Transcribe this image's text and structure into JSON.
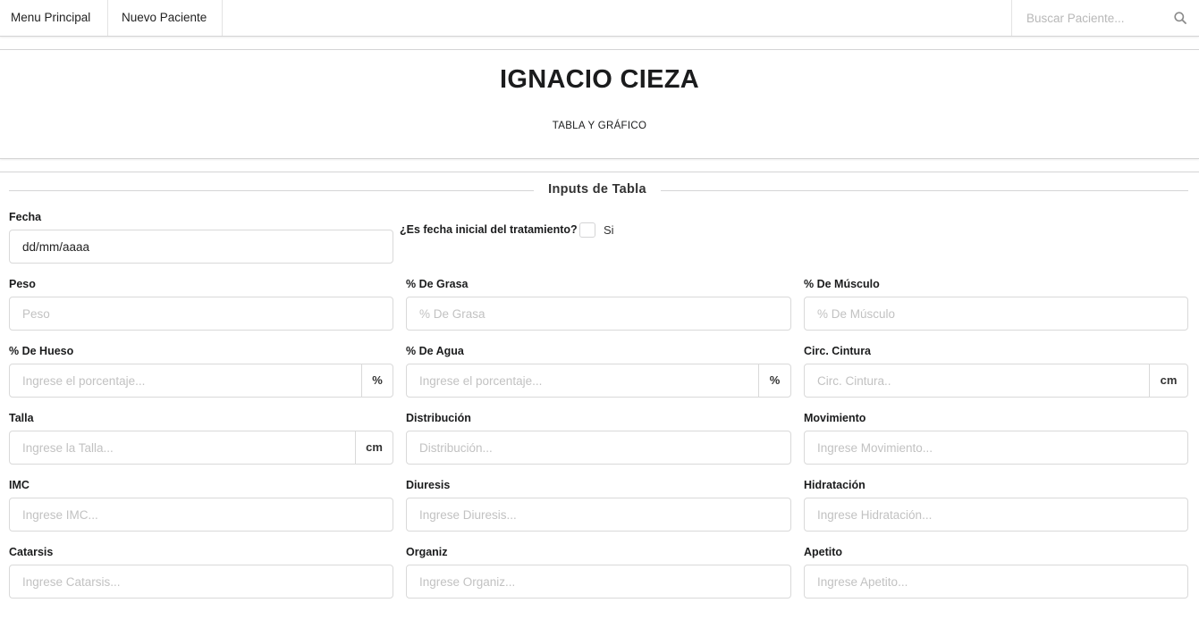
{
  "nav": {
    "menu_principal": "Menu Principal",
    "nuevo_paciente": "Nuevo Paciente",
    "search_placeholder": "Buscar Paciente...",
    "search_icon": "search-icon"
  },
  "header": {
    "patient_name": "IGNACIO CIEZA",
    "subtitle": "TABLA Y GRÁFICO"
  },
  "form": {
    "divider_title": "Inputs de Tabla",
    "fecha": {
      "label": "Fecha",
      "value": "dd/mm/aaaa"
    },
    "fecha_inicial": {
      "question": "¿Es fecha inicial del tratamiento?",
      "option": "Si",
      "checked": false
    },
    "peso": {
      "label": "Peso",
      "placeholder": "Peso"
    },
    "grasa": {
      "label": "% De Grasa",
      "placeholder": "% De Grasa"
    },
    "musculo": {
      "label": "% De Músculo",
      "placeholder": "% De Músculo"
    },
    "hueso": {
      "label": "% De Hueso",
      "placeholder": "Ingrese el porcentaje...",
      "addon": "%"
    },
    "agua": {
      "label": "% De Agua",
      "placeholder": "Ingrese el porcentaje...",
      "addon": "%"
    },
    "cintura": {
      "label": "Circ. Cintura",
      "placeholder": "Circ. Cintura..",
      "addon": "cm"
    },
    "talla": {
      "label": "Talla",
      "placeholder": "Ingrese la Talla...",
      "addon": "cm"
    },
    "distribucion": {
      "label": "Distribución",
      "placeholder": "Distribución..."
    },
    "movimiento": {
      "label": "Movimiento",
      "placeholder": "Ingrese Movimiento..."
    },
    "imc": {
      "label": "IMC",
      "placeholder": "Ingrese IMC..."
    },
    "diuresis": {
      "label": "Diuresis",
      "placeholder": "Ingrese Diuresis..."
    },
    "hidratacion": {
      "label": "Hidratación",
      "placeholder": "Ingrese Hidratación..."
    },
    "catarsis": {
      "label": "Catarsis",
      "placeholder": "Ingrese Catarsis..."
    },
    "organiz": {
      "label": "Organiz",
      "placeholder": "Ingrese Organiz..."
    },
    "apetito": {
      "label": "Apetito",
      "placeholder": "Ingrese Apetito..."
    }
  }
}
